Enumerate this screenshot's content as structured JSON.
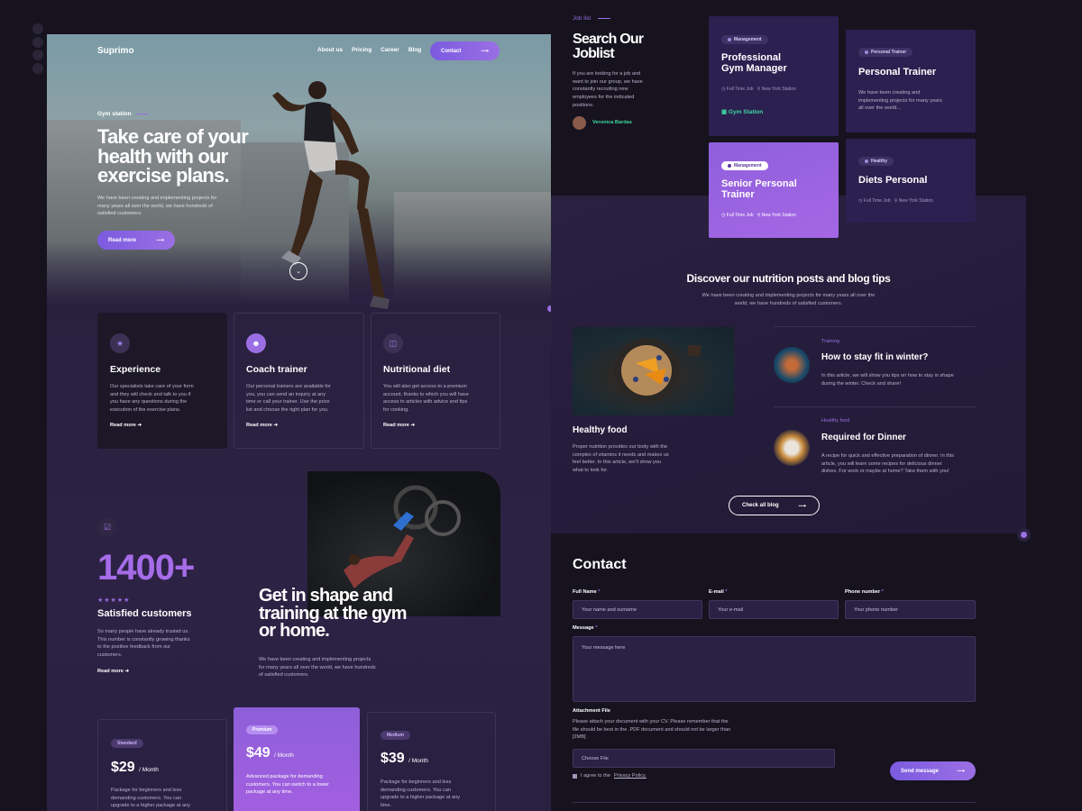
{
  "brand": "Suprimo",
  "nav": [
    "About us",
    "Pricing",
    "Career",
    "Blog"
  ],
  "contact_btn": "Contact",
  "hero": {
    "eyebrow": "Gym station",
    "title_1": "Take care of your",
    "title_2": "health with our",
    "title_3": "exercise plans.",
    "text_1": "We have been creating and implementing projects for",
    "text_2": "many years all over the world, we have hundreds of",
    "text_3": "satisfied customers.",
    "cta": "Read more"
  },
  "features": [
    {
      "title": "Experience",
      "icon": "star-icon",
      "lines": [
        "Our specialists take care of your form",
        "and they will check and talk to you if",
        "you have any questions during the",
        "execution of the exercise plans."
      ],
      "link": "Read more"
    },
    {
      "title": "Coach trainer",
      "icon": "coach-icon",
      "lines": [
        "Our personal trainers are available for",
        "you, you can send an inquiry at any",
        "time or call your trainer. Use the price",
        "list and choose the right plan for you."
      ],
      "link": "Read more"
    },
    {
      "title": "Nutritional diet",
      "icon": "cup-icon",
      "lines": [
        "You will also get access to a premium",
        "account, thanks to which you will have",
        "access to articles with advice and tips",
        "for cooking."
      ],
      "link": "Read more"
    }
  ],
  "stats": {
    "number": "1400+",
    "stars": "★★★★★",
    "label": "Satisfied customers",
    "lines": [
      "So many people have already trusted us.",
      "This number is constantly growing thanks",
      "to the positive feedback from our",
      "customers."
    ],
    "link": "Read more"
  },
  "shape": {
    "title_1": "Get in shape and",
    "title_2": "training at the gym",
    "title_3": "or home.",
    "lines": [
      "We have been creating and implementing projects",
      "for many years all over the world, we have hundreds",
      "of satisfied customers."
    ]
  },
  "pricing": [
    {
      "tag": "Standard",
      "price": "$29",
      "period": "/ Month",
      "lines": [
        "Package for beginners and less",
        "demanding customers. You can",
        "upgrade to a higher package at any"
      ]
    },
    {
      "tag": "Premium",
      "price": "$49",
      "period": "/ Month",
      "lines": [
        "Advanced package for demanding",
        "customers. You can switch to a lower",
        "package at any time."
      ]
    },
    {
      "tag": "Medium",
      "price": "$39",
      "period": "/ Month",
      "lines": [
        "Package for beginners and less",
        "demanding customers. You can",
        "upgrade to a higher package at any",
        "time."
      ]
    }
  ],
  "joblist": {
    "eyebrow": "Job list",
    "title_1": "Search Our",
    "title_2": "Joblist",
    "lines": [
      "If you are looking for a job and",
      "want to join our group, we have",
      "constantly recruiting new",
      "employees for the indicated",
      "positions."
    ],
    "author": "Veronica Bardas"
  },
  "jobs": [
    {
      "chip": "Management",
      "title_1": "Professional",
      "title_2": "Gym Manager",
      "type": "Full Time Job",
      "loc": "New York Station",
      "extra": "Gym Station"
    },
    {
      "chip": "Personal Trainer",
      "title_1": "Personal Trainer",
      "lines": [
        "We have been creating and",
        "implementing projects for many years",
        "all over the world..."
      ]
    },
    {
      "chip": "Management",
      "title_1": "Senior Personal",
      "title_2": "Trainer",
      "type": "Full Time Job",
      "loc": "New York Station"
    },
    {
      "chip": "Healthy",
      "title_1": "Diets Personal",
      "type": "Full Time Job",
      "loc": "New York Station"
    }
  ],
  "blog": {
    "title": "Discover our nutrition posts and blog tips",
    "sub_1": "We have been creating and implementing projects for many years all over the",
    "sub_2": "world, we have hundreds of satisfied customers.",
    "feature_title": "Healthy food",
    "feature_lines": [
      "Proper nutrition provides our body with the",
      "complex of vitamins it needs and makes us",
      "feel better. In this article, we'll show you",
      "what to look for."
    ],
    "posts": [
      {
        "cat": "Training",
        "title": "How to stay fit in winter?",
        "lines": [
          "In this article, we will show you tips on how to stay in shape",
          "during the winter. Check and share!"
        ]
      },
      {
        "cat": "Healthy food",
        "title": "Required for Dinner",
        "lines": [
          "A recipe for quick and effective preparation of dinner. In this",
          "article, you will learn some recipes for delicious dinner",
          "dishes. For work or maybe at home? Take them with you!"
        ]
      }
    ],
    "cta": "Check all blog"
  },
  "contact": {
    "title": "Contact",
    "full_name": "Full Name",
    "email": "E-mail",
    "phone": "Phone number",
    "ph_name": "Your name and surname",
    "ph_email": "Your e-mail",
    "ph_phone": "Your phone number",
    "message": "Message",
    "ph_message": "Your message here",
    "attach": "Attachment File",
    "attach_lines": [
      "Please attach your document with your CV. Please remember that the",
      "file should be best in the .PDF document and should not be larger than",
      "[2MB]"
    ],
    "choose": "Choose File",
    "agree": "I agree to the",
    "policy": "Privacy Policy.",
    "send": "Send message"
  },
  "colors": {
    "accent": "#9b6fe4",
    "bg": "#16131f",
    "green": "#3ed6a0"
  }
}
